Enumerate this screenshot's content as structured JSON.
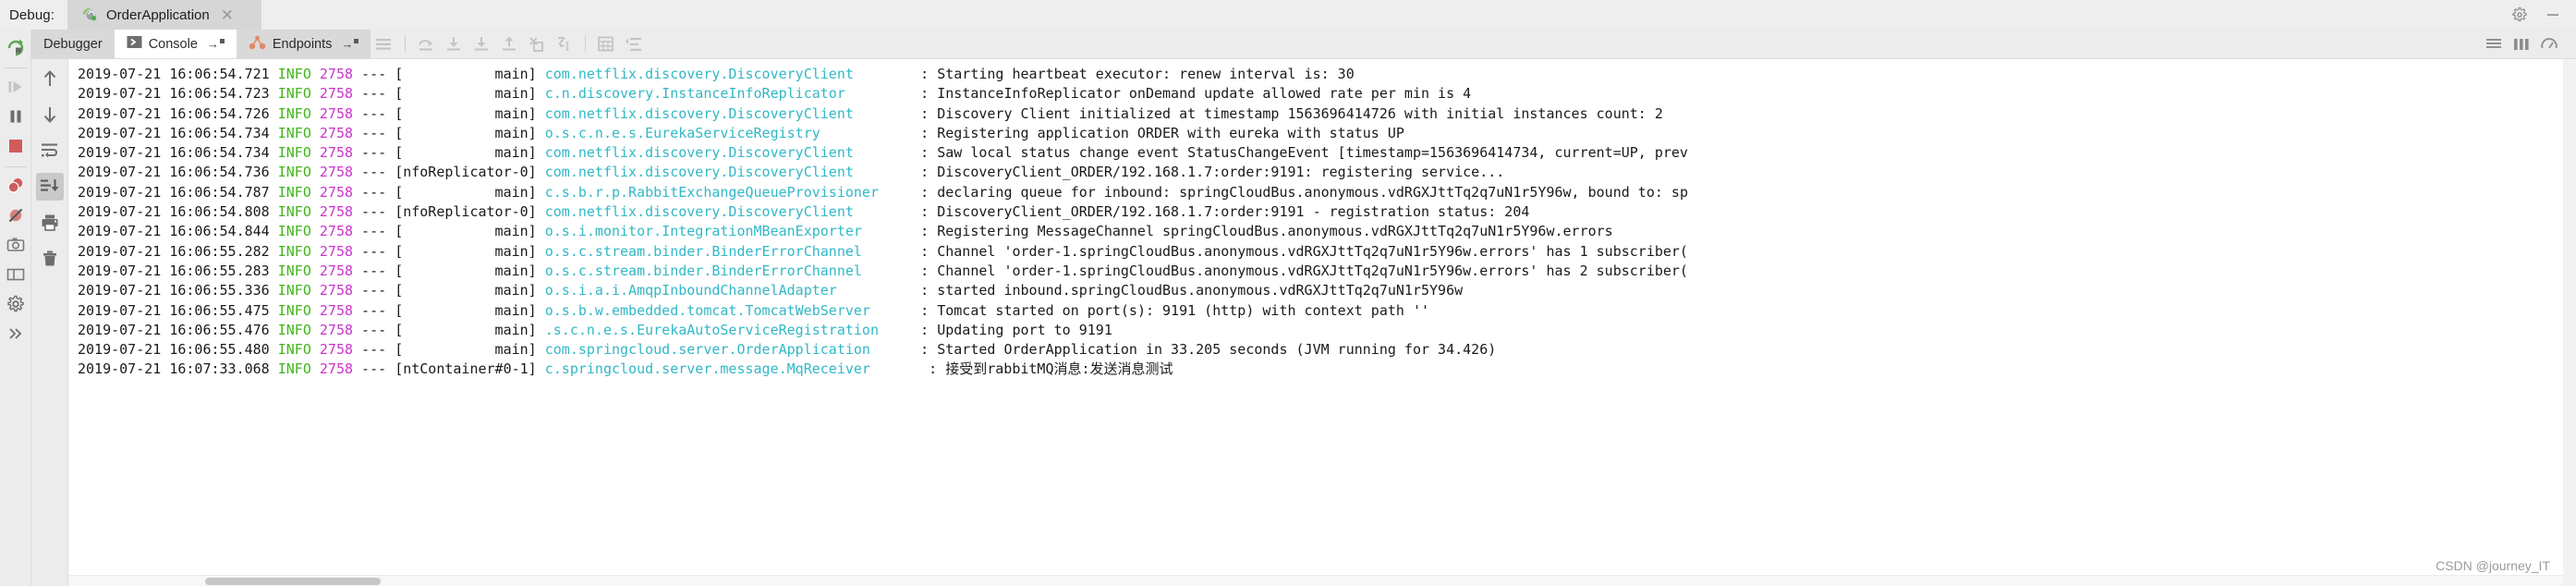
{
  "titlebar": {
    "debug_label": "Debug:",
    "run_config_name": "OrderApplication",
    "close_label": "✕",
    "settings_icon": "gear-icon",
    "minimize_icon": "minimize-icon"
  },
  "rail": {
    "items": [
      {
        "name": "rerun-button",
        "icon": "rerun-icon",
        "enabled": true
      },
      {
        "name": "resume-program-button",
        "icon": "resume-icon",
        "enabled": false
      },
      {
        "name": "pause-program-button",
        "icon": "pause-icon",
        "enabled": true
      },
      {
        "name": "stop-button",
        "icon": "stop-icon",
        "enabled": true
      },
      {
        "name": "view-breakpoints-button",
        "icon": "breakpoints-icon",
        "enabled": true
      },
      {
        "name": "mute-breakpoints-button",
        "icon": "mute-breakpoints-icon",
        "enabled": true
      },
      {
        "name": "settings-button",
        "icon": "gear-icon",
        "enabled": true
      },
      {
        "name": "more-button",
        "icon": "chevrons-right-icon",
        "enabled": true
      }
    ]
  },
  "tabs": [
    {
      "label": "Debugger",
      "icon": "",
      "state": "inactive"
    },
    {
      "label": "Console",
      "icon": "console-icon",
      "state": "active"
    },
    {
      "label": "Endpoints",
      "icon": "endpoints-icon",
      "state": "semi"
    }
  ],
  "toolbar": {
    "buttons": [
      {
        "name": "layout-settings-button",
        "icon": "layout-icon"
      },
      {
        "name": "step-over-button",
        "icon": "step-over-icon"
      },
      {
        "name": "step-into-button",
        "icon": "step-into-icon"
      },
      {
        "name": "force-step-into-button",
        "icon": "force-step-into-icon"
      },
      {
        "name": "step-out-button",
        "icon": "step-out-icon"
      },
      {
        "name": "drop-frame-button",
        "icon": "drop-frame-icon"
      },
      {
        "name": "run-to-cursor-button",
        "icon": "run-to-cursor-icon"
      },
      {
        "name": "evaluate-expression-button",
        "icon": "calculator-icon"
      },
      {
        "name": "sort-button",
        "icon": "sort-icon"
      }
    ],
    "right_buttons": [
      {
        "name": "list-view-button",
        "icon": "list-icon"
      },
      {
        "name": "columns-view-button",
        "icon": "columns-icon"
      },
      {
        "name": "analyze-button",
        "icon": "gauge-icon"
      }
    ]
  },
  "gutter": {
    "items": [
      {
        "name": "scroll-up-button",
        "icon": "arrow-up-icon",
        "active": false
      },
      {
        "name": "scroll-down-button",
        "icon": "arrow-down-icon",
        "active": false
      },
      {
        "name": "soft-wrap-button",
        "icon": "soft-wrap-icon",
        "active": false
      },
      {
        "name": "scroll-to-end-button",
        "icon": "scroll-to-end-icon",
        "active": true
      },
      {
        "name": "print-button",
        "icon": "print-icon",
        "active": false
      },
      {
        "name": "clear-all-button",
        "icon": "trash-icon",
        "active": false
      }
    ]
  },
  "console": {
    "lines": [
      {
        "ts": "2019-07-21 16:06:54.721",
        "level": "INFO",
        "pid": "2758",
        "dash": "---",
        "thread": "[           main]",
        "logger": "com.netflix.discovery.DiscoveryClient",
        "logger_pad": "       ",
        "message": ": Starting heartbeat executor: renew interval is: 30"
      },
      {
        "ts": "2019-07-21 16:06:54.723",
        "level": "INFO",
        "pid": "2758",
        "dash": "---",
        "thread": "[           main]",
        "logger": "c.n.discovery.InstanceInfoReplicator",
        "logger_pad": "        ",
        "message": ": InstanceInfoReplicator onDemand update allowed rate per min is 4"
      },
      {
        "ts": "2019-07-21 16:06:54.726",
        "level": "INFO",
        "pid": "2758",
        "dash": "---",
        "thread": "[           main]",
        "logger": "com.netflix.discovery.DiscoveryClient",
        "logger_pad": "       ",
        "message": ": Discovery Client initialized at timestamp 1563696414726 with initial instances count: 2"
      },
      {
        "ts": "2019-07-21 16:06:54.734",
        "level": "INFO",
        "pid": "2758",
        "dash": "---",
        "thread": "[           main]",
        "logger": "o.s.c.n.e.s.EurekaServiceRegistry",
        "logger_pad": "           ",
        "message": ": Registering application ORDER with eureka with status UP"
      },
      {
        "ts": "2019-07-21 16:06:54.734",
        "level": "INFO",
        "pid": "2758",
        "dash": "---",
        "thread": "[           main]",
        "logger": "com.netflix.discovery.DiscoveryClient",
        "logger_pad": "       ",
        "message": ": Saw local status change event StatusChangeEvent [timestamp=1563696414734, current=UP, prev"
      },
      {
        "ts": "2019-07-21 16:06:54.736",
        "level": "INFO",
        "pid": "2758",
        "dash": "---",
        "thread": "[nfoReplicator-0]",
        "logger": "com.netflix.discovery.DiscoveryClient",
        "logger_pad": "       ",
        "message": ": DiscoveryClient_ORDER/192.168.1.7:order:9191: registering service..."
      },
      {
        "ts": "2019-07-21 16:06:54.787",
        "level": "INFO",
        "pid": "2758",
        "dash": "---",
        "thread": "[           main]",
        "logger": "c.s.b.r.p.RabbitExchangeQueueProvisioner",
        "logger_pad": "    ",
        "message": ": declaring queue for inbound: springCloudBus.anonymous.vdRGXJttTq2q7uN1r5Y96w, bound to: sp"
      },
      {
        "ts": "2019-07-21 16:06:54.808",
        "level": "INFO",
        "pid": "2758",
        "dash": "---",
        "thread": "[nfoReplicator-0]",
        "logger": "com.netflix.discovery.DiscoveryClient",
        "logger_pad": "       ",
        "message": ": DiscoveryClient_ORDER/192.168.1.7:order:9191 - registration status: 204"
      },
      {
        "ts": "2019-07-21 16:06:54.844",
        "level": "INFO",
        "pid": "2758",
        "dash": "---",
        "thread": "[           main]",
        "logger": "o.s.i.monitor.IntegrationMBeanExporter",
        "logger_pad": "      ",
        "message": ": Registering MessageChannel springCloudBus.anonymous.vdRGXJttTq2q7uN1r5Y96w.errors"
      },
      {
        "ts": "2019-07-21 16:06:55.282",
        "level": "INFO",
        "pid": "2758",
        "dash": "---",
        "thread": "[           main]",
        "logger": "o.s.c.stream.binder.BinderErrorChannel",
        "logger_pad": "      ",
        "message": ": Channel 'order-1.springCloudBus.anonymous.vdRGXJttTq2q7uN1r5Y96w.errors' has 1 subscriber("
      },
      {
        "ts": "2019-07-21 16:06:55.283",
        "level": "INFO",
        "pid": "2758",
        "dash": "---",
        "thread": "[           main]",
        "logger": "o.s.c.stream.binder.BinderErrorChannel",
        "logger_pad": "      ",
        "message": ": Channel 'order-1.springCloudBus.anonymous.vdRGXJttTq2q7uN1r5Y96w.errors' has 2 subscriber("
      },
      {
        "ts": "2019-07-21 16:06:55.336",
        "level": "INFO",
        "pid": "2758",
        "dash": "---",
        "thread": "[           main]",
        "logger": "o.s.i.a.i.AmqpInboundChannelAdapter",
        "logger_pad": "         ",
        "message": ": started inbound.springCloudBus.anonymous.vdRGXJttTq2q7uN1r5Y96w"
      },
      {
        "ts": "2019-07-21 16:06:55.475",
        "level": "INFO",
        "pid": "2758",
        "dash": "---",
        "thread": "[           main]",
        "logger": "o.s.b.w.embedded.tomcat.TomcatWebServer",
        "logger_pad": "     ",
        "message": ": Tomcat started on port(s): 9191 (http) with context path ''"
      },
      {
        "ts": "2019-07-21 16:06:55.476",
        "level": "INFO",
        "pid": "2758",
        "dash": "---",
        "thread": "[           main]",
        "logger": ".s.c.n.e.s.EurekaAutoServiceRegistration",
        "logger_pad": "    ",
        "message": ": Updating port to 9191"
      },
      {
        "ts": "2019-07-21 16:06:55.480",
        "level": "INFO",
        "pid": "2758",
        "dash": "---",
        "thread": "[           main]",
        "logger": "com.springcloud.server.OrderApplication",
        "logger_pad": "     ",
        "message": ": Started OrderApplication in 33.205 seconds (JVM running for 34.426)"
      },
      {
        "ts": "2019-07-21 16:07:33.068",
        "level": "INFO",
        "pid": "2758",
        "dash": "---",
        "thread": "[ntContainer#0-1]",
        "logger": "c.springcloud.server.message.MqReceiver",
        "logger_pad": "      ",
        "message": ": 接受到rabbitMQ消息:发送消息测试"
      }
    ]
  },
  "watermark": "CSDN @journey_IT"
}
